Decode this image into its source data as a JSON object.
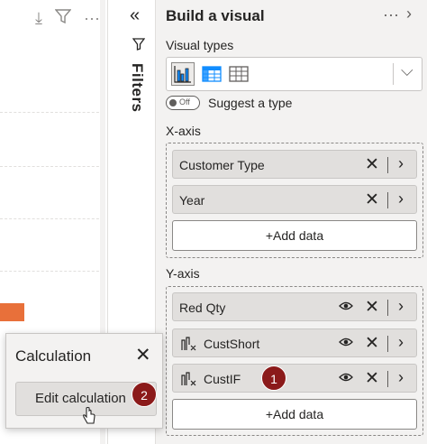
{
  "canvas": {
    "icons": [
      "drill-icon",
      "filter-icon",
      "more-icon"
    ],
    "bar_color": "#e8703a"
  },
  "filters_pane": {
    "collapse_glyph": "«",
    "label": "Filters"
  },
  "build_visual": {
    "title": "Build a visual",
    "visual_types_label": "Visual types",
    "suggest_toggle_state": "Off",
    "suggest_label": "Suggest a type",
    "x_axis": {
      "label": "X-axis",
      "fields": [
        {
          "name": "Customer Type"
        },
        {
          "name": "Year"
        }
      ],
      "add_label": "+Add data"
    },
    "y_axis": {
      "label": "Y-axis",
      "fields": [
        {
          "name": "Red Qty",
          "icon": false
        },
        {
          "name": "CustShort",
          "icon": true
        },
        {
          "name": "CustIF",
          "icon": true
        }
      ],
      "add_label": "+Add data"
    }
  },
  "calculation_popup": {
    "title": "Calculation",
    "edit_button": "Edit calculation"
  },
  "badges": {
    "one": "1",
    "two": "2",
    "color": "#8b1a1a"
  }
}
